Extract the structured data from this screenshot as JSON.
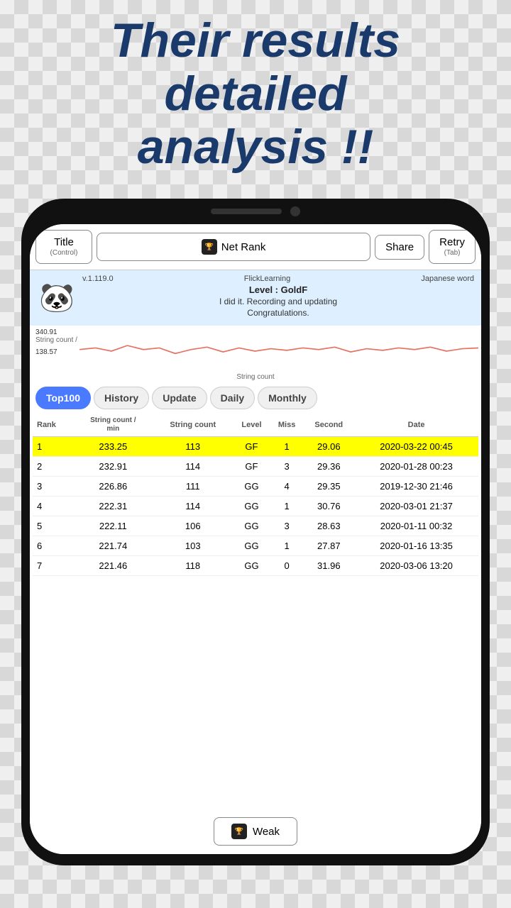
{
  "headline": {
    "line1": "Their results",
    "line2": "detailed",
    "line3": "analysis !!"
  },
  "toolbar": {
    "title_label": "Title",
    "title_sub": "(Control)",
    "netrank_label": "Net Rank",
    "share_label": "Share",
    "retry_label": "Retry",
    "retry_sub": "(Tab)"
  },
  "info": {
    "version": "v.1.119.0",
    "app_name": "FlickLearning",
    "level": "Level : GoldF",
    "congrats": "I did it. Recording and updating",
    "congrats2": "Congratulations.",
    "mode": "Japanese word"
  },
  "chart": {
    "top_value": "340.91",
    "label_prefix": "String count /",
    "bottom_value": "138.57",
    "x_label": "String count"
  },
  "tabs": [
    {
      "id": "top100",
      "label": "Top100",
      "active": true
    },
    {
      "id": "history",
      "label": "History",
      "active": false
    },
    {
      "id": "update",
      "label": "Update",
      "active": false
    },
    {
      "id": "daily",
      "label": "Daily",
      "active": false
    },
    {
      "id": "monthly",
      "label": "Monthly",
      "active": false
    }
  ],
  "table": {
    "headers": {
      "rank": "Rank",
      "string_count_min": "String count / min",
      "string_count": "String count",
      "level": "Level",
      "miss": "Miss",
      "second": "Second",
      "date": "Date"
    },
    "rows": [
      {
        "rank": 1,
        "string_count_min": "233.25",
        "string_count": "113",
        "level": "GF",
        "miss": "1",
        "second": "29.06",
        "date": "2020-03-22 00:45",
        "highlight": true
      },
      {
        "rank": 2,
        "string_count_min": "232.91",
        "string_count": "114",
        "level": "GF",
        "miss": "3",
        "second": "29.36",
        "date": "2020-01-28 00:23",
        "highlight": false
      },
      {
        "rank": 3,
        "string_count_min": "226.86",
        "string_count": "111",
        "level": "GG",
        "miss": "4",
        "second": "29.35",
        "date": "2019-12-30 21:46",
        "highlight": false
      },
      {
        "rank": 4,
        "string_count_min": "222.31",
        "string_count": "114",
        "level": "GG",
        "miss": "1",
        "second": "30.76",
        "date": "2020-03-01 21:37",
        "highlight": false
      },
      {
        "rank": 5,
        "string_count_min": "222.11",
        "string_count": "106",
        "level": "GG",
        "miss": "3",
        "second": "28.63",
        "date": "2020-01-11 00:32",
        "highlight": false
      },
      {
        "rank": 6,
        "string_count_min": "221.74",
        "string_count": "103",
        "level": "GG",
        "miss": "1",
        "second": "27.87",
        "date": "2020-01-16 13:35",
        "highlight": false
      },
      {
        "rank": 7,
        "string_count_min": "221.46",
        "string_count": "118",
        "level": "GG",
        "miss": "0",
        "second": "31.96",
        "date": "2020-03-06 13:20",
        "highlight": false
      }
    ]
  },
  "weak_button": {
    "label": "Weak"
  }
}
